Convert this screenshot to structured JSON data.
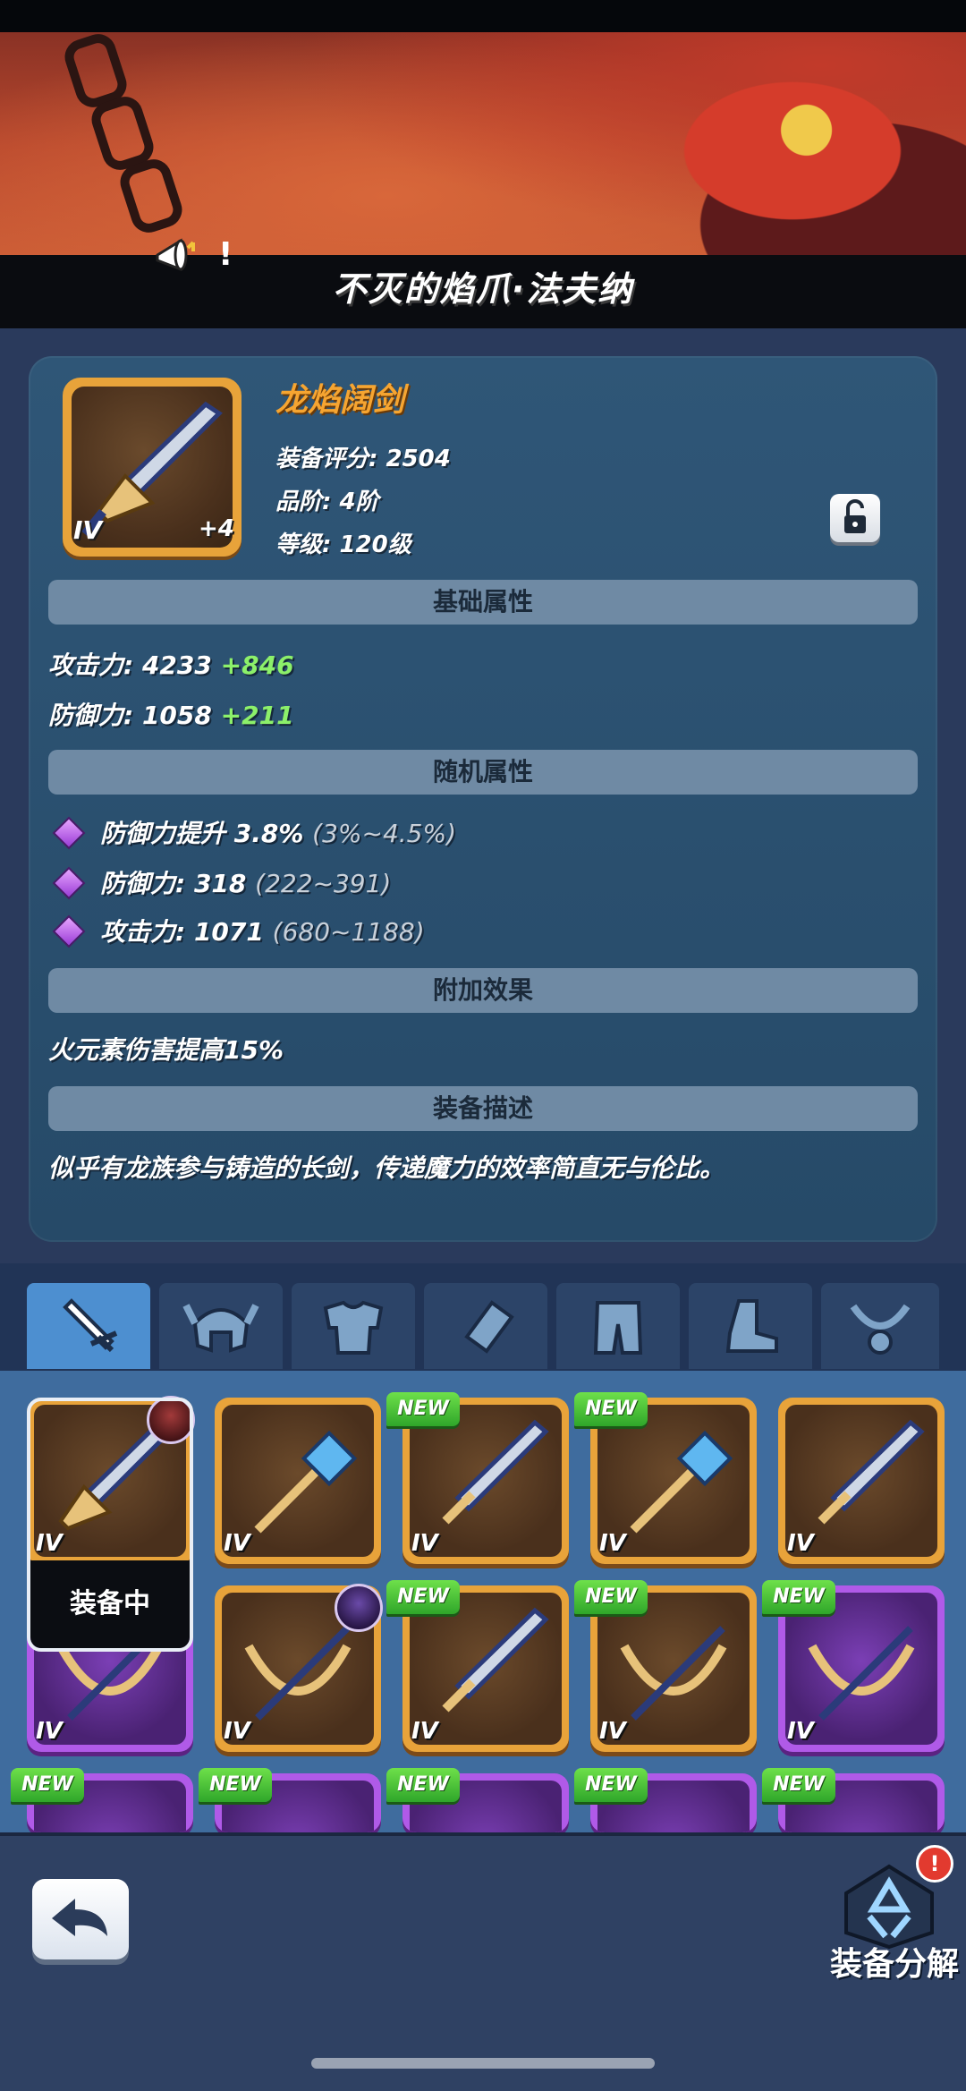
{
  "banner": {
    "boss_name": "不灭的焰爪·法夫纳",
    "announce_mark": "!"
  },
  "item": {
    "name": "龙焰阔剑",
    "tier": "IV",
    "enhance": "+4",
    "score_label": "装备评分:",
    "score_value": "2504",
    "grade_label": "品阶:",
    "grade_value": "4阶",
    "level_label": "等级:",
    "level_value": "120级"
  },
  "sections": {
    "base": "基础属性",
    "random": "随机属性",
    "extra": "附加效果",
    "desc": "装备描述"
  },
  "base_attrs": [
    {
      "label": "攻击力:",
      "value": "4233",
      "bonus": "+846"
    },
    {
      "label": "防御力:",
      "value": "1058",
      "bonus": "+211"
    }
  ],
  "random_attrs": [
    {
      "text": "防御力提升 3.8%",
      "range": "(3%~4.5%)"
    },
    {
      "text": "防御力: 318",
      "range": "(222~391)"
    },
    {
      "text": "攻击力: 1071",
      "range": "(680~1188)"
    }
  ],
  "extra_effect": "火元素伤害提高15%",
  "description": "似乎有龙族参与铸造的长剑，传递魔力的效率简直无与伦比。",
  "tabs": [
    "sword-icon",
    "helmet-icon",
    "armor-icon",
    "bracer-icon",
    "pants-icon",
    "boots-icon",
    "necklace-icon"
  ],
  "inventory": {
    "equipped_label": "装备中",
    "new_label": "NEW",
    "tier": "IV"
  },
  "bottom": {
    "dismantle_label": "装备分解",
    "alert": "!"
  },
  "colors": {
    "item_name": "#f6a531",
    "bonus_green": "#8cf06a",
    "slot_gold": "#e8a33a",
    "slot_purple": "#b05ae8",
    "tab_active": "#4d8fd0"
  }
}
